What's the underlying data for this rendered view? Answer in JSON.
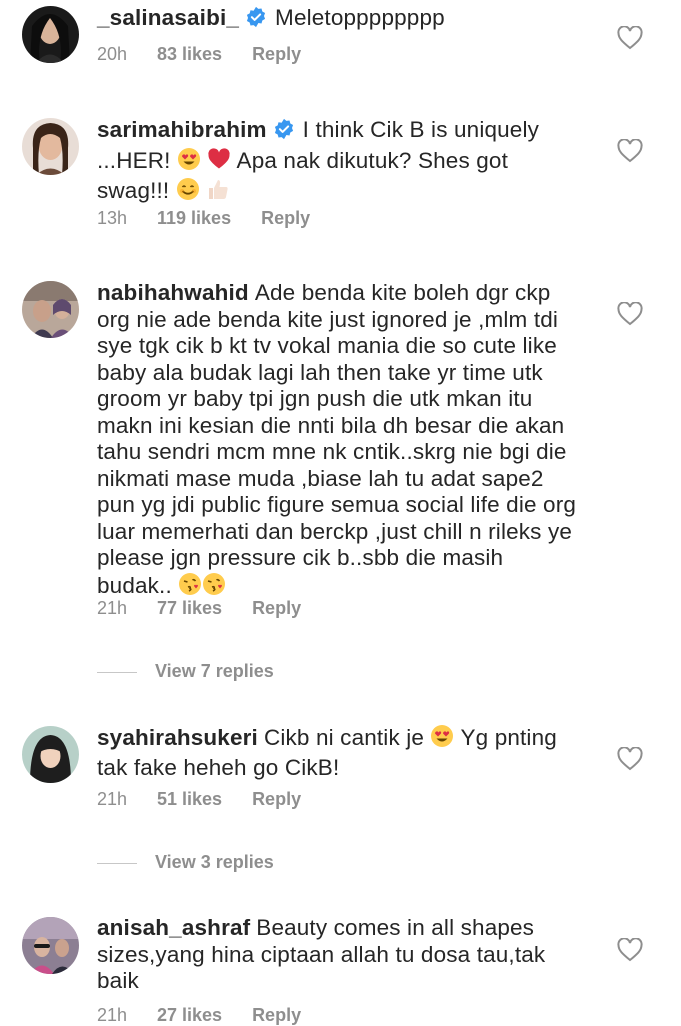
{
  "comments": [
    {
      "username": "_salinasaibi_",
      "verified": true,
      "text": "Meletopppppppp",
      "time": "20h",
      "likes": "83 likes",
      "reply": "Reply"
    },
    {
      "username": "sarimahibrahim",
      "verified": true,
      "text_parts": [
        "I think Cik B is uniquely ...HER!",
        "Apa nak dikutuk? Shes got swag!!!"
      ],
      "time": "13h",
      "likes": "119 likes",
      "reply": "Reply"
    },
    {
      "username": "nabihahwahid",
      "verified": false,
      "text": "Ade benda kite boleh dgr ckp org nie ade benda kite just ignored je ,mlm tdi sye tgk cik b kt tv vokal mania die so cute like baby ala budak lagi lah then take yr time utk groom yr baby tpi jgn push die utk mkan itu makn ini kesian die nnti bila dh besar die akan tahu sendri mcm mne nk cntik..skrg nie bgi die nikmati mase muda ,biase lah tu  adat sape2 pun yg jdi public figure semua social life die org luar memerhati dan berckp ,just chill n rileks ye please jgn pressure cik b..sbb die masih budak..",
      "time": "21h",
      "likes": "77 likes",
      "reply": "Reply",
      "view_replies": "View 7 replies"
    },
    {
      "username": "syahirahsukeri",
      "verified": false,
      "text_parts": [
        "Cikb ni cantik je",
        "Yg pnting tak fake heheh go CikB!"
      ],
      "time": "21h",
      "likes": "51 likes",
      "reply": "Reply",
      "view_replies": "View 3 replies"
    },
    {
      "username": "anisah_ashraf",
      "verified": false,
      "text": "Beauty comes in all shapes sizes,yang hina ciptaan allah tu dosa tau,tak baik",
      "time": "21h",
      "likes": "27 likes",
      "reply": "Reply"
    }
  ],
  "icons": {
    "like": "heart-outline-icon",
    "verified": "verified-badge-icon",
    "emoji_heart_eyes": "heart-eyes-emoji",
    "emoji_red_heart": "red-heart-emoji",
    "emoji_smile": "smiling-face-emoji",
    "emoji_thumbs_up": "thumbs-up-emoji",
    "emoji_kiss": "face-blowing-kiss-emoji"
  },
  "colors": {
    "text": "#262626",
    "secondary": "#8e8e8e",
    "verified": "#3897f0"
  }
}
